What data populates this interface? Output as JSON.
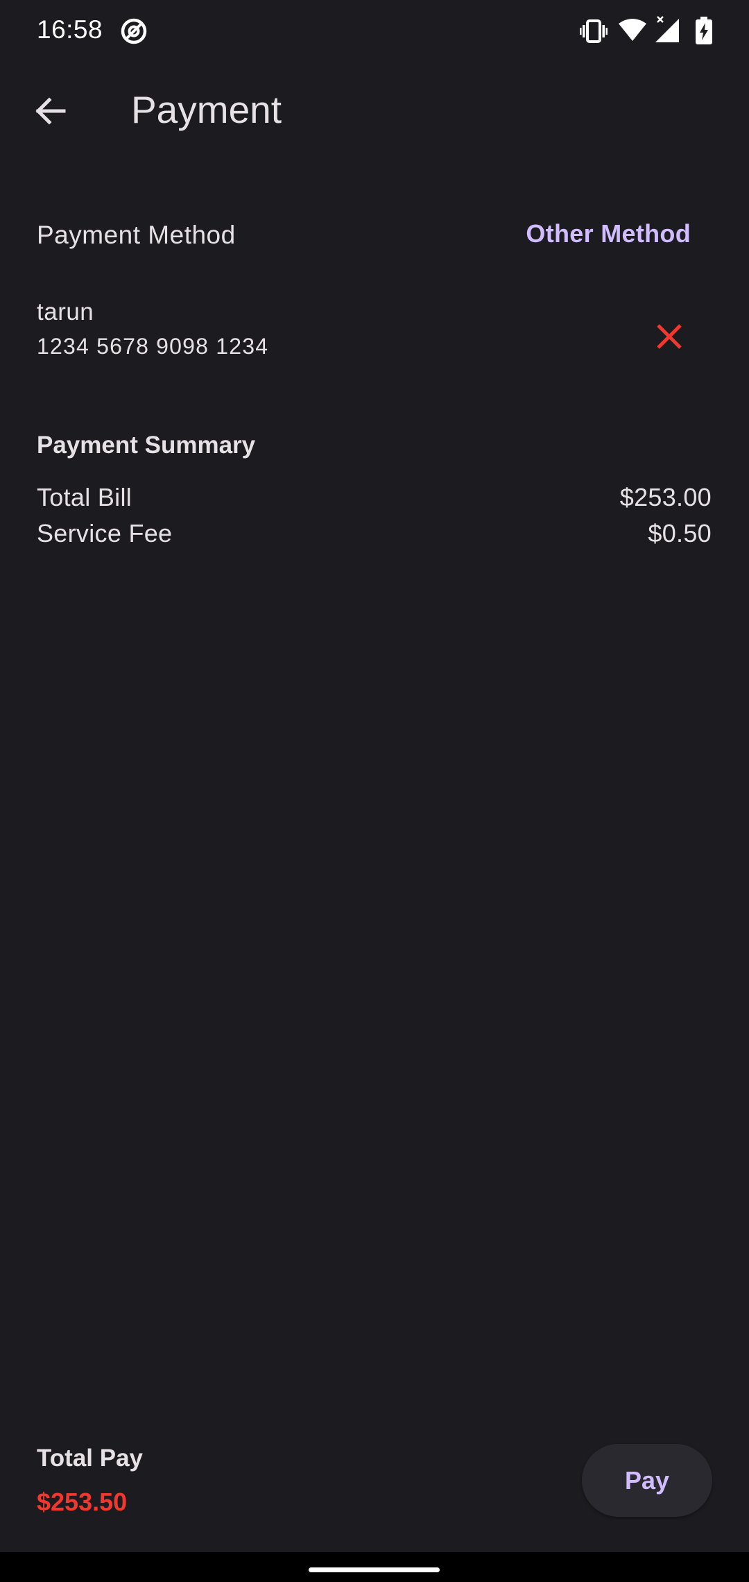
{
  "status_bar": {
    "time": "16:58",
    "icons": [
      "at-sign-icon",
      "vibrate-icon",
      "wifi-icon",
      "signal-icon",
      "battery-charging-icon"
    ]
  },
  "app_bar": {
    "back_icon": "arrow-back-icon",
    "title": "Payment"
  },
  "payment_method": {
    "label": "Payment Method",
    "other_method_label": "Other Method",
    "card": {
      "name": "tarun",
      "number": "1234 5678 9098 1234",
      "remove_icon": "close-icon"
    }
  },
  "summary": {
    "title": "Payment Summary",
    "rows": [
      {
        "label": "Total Bill",
        "value": "$253.00"
      },
      {
        "label": "Service Fee",
        "value": "$0.50"
      }
    ]
  },
  "footer": {
    "total_label": "Total Pay",
    "total_value": "$253.50",
    "pay_label": "Pay"
  },
  "colors": {
    "background": "#1c1b1f",
    "accent": "#d0bcff",
    "danger": "#f2382e",
    "text": "#e6e1e5"
  }
}
